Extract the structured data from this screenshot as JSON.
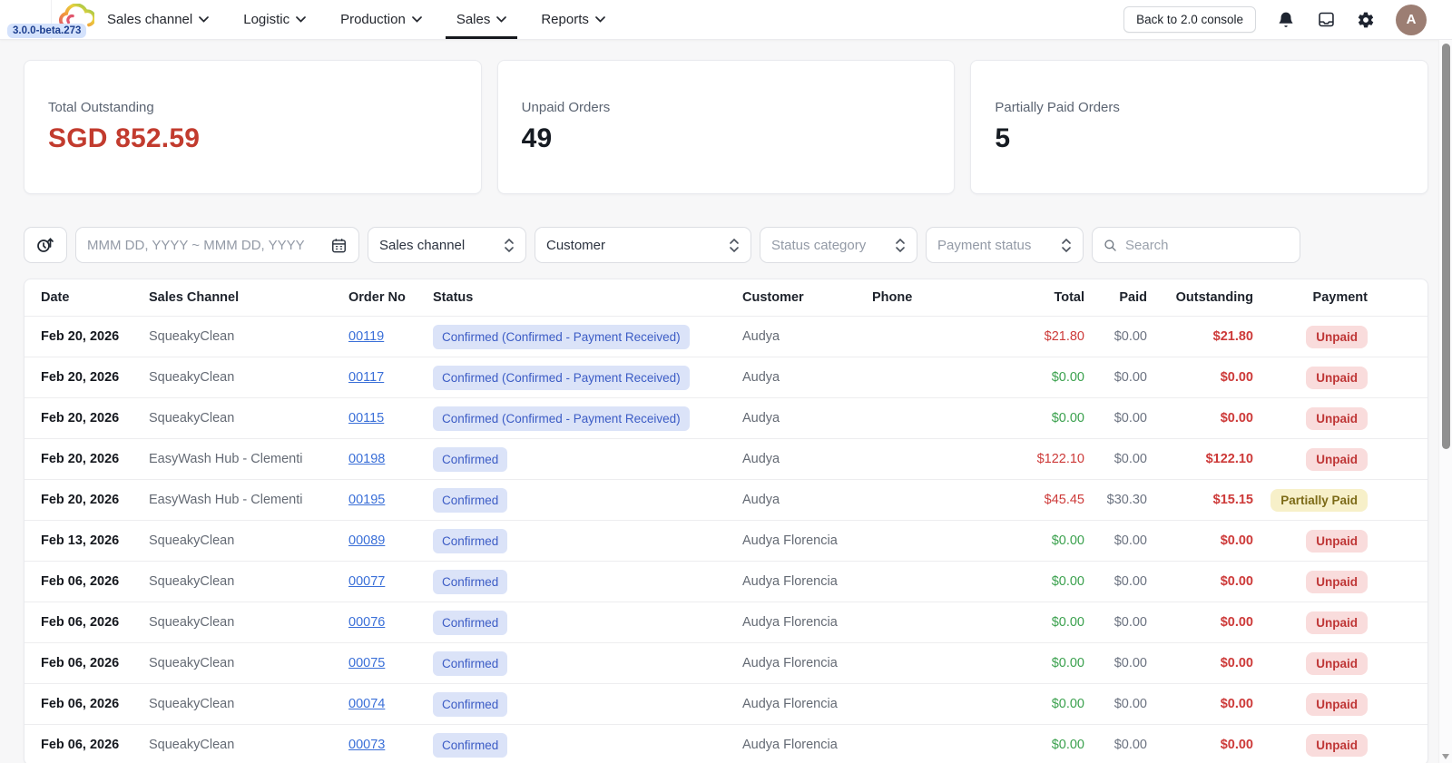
{
  "app": {
    "version_badge": "3.0.0-beta.273",
    "nav": [
      {
        "label": "Sales channel",
        "active": false
      },
      {
        "label": "Logistic",
        "active": false
      },
      {
        "label": "Production",
        "active": false
      },
      {
        "label": "Sales",
        "active": true
      },
      {
        "label": "Reports",
        "active": false
      }
    ],
    "back_button_label": "Back to 2.0 console",
    "avatar_initial": "A"
  },
  "cards": [
    {
      "label": "Total Outstanding",
      "value": "SGD 852.59"
    },
    {
      "label": "Unpaid Orders",
      "value": "49"
    },
    {
      "label": "Partially Paid Orders",
      "value": "5"
    }
  ],
  "filters": {
    "date_range_placeholder": "MMM DD, YYYY ~ MMM DD, YYYY",
    "dropdowns": [
      "Sales channel",
      "Customer",
      "Status category",
      "Payment status"
    ],
    "search_placeholder": "Search"
  },
  "table": {
    "columns": [
      "Date",
      "Sales Channel",
      "Order No",
      "Status",
      "Customer",
      "Phone",
      "Total",
      "Paid",
      "Outstanding",
      "Payment"
    ],
    "rows": [
      {
        "date": "Feb 20, 2026",
        "channel": "SqueakyClean",
        "order_no": "00119",
        "status": "Confirmed (Confirmed - Payment Received)",
        "customer": "Audya",
        "phone": "",
        "total": "$21.80",
        "paid": "$0.00",
        "outstanding": "$21.80",
        "payment": "Unpaid"
      },
      {
        "date": "Feb 20, 2026",
        "channel": "SqueakyClean",
        "order_no": "00117",
        "status": "Confirmed (Confirmed - Payment Received)",
        "customer": "Audya",
        "phone": "",
        "total": "$0.00",
        "paid": "$0.00",
        "outstanding": "$0.00",
        "payment": "Unpaid"
      },
      {
        "date": "Feb 20, 2026",
        "channel": "SqueakyClean",
        "order_no": "00115",
        "status": "Confirmed (Confirmed - Payment Received)",
        "customer": "Audya",
        "phone": "",
        "total": "$0.00",
        "paid": "$0.00",
        "outstanding": "$0.00",
        "payment": "Unpaid"
      },
      {
        "date": "Feb 20, 2026",
        "channel": "EasyWash Hub - Clementi",
        "order_no": "00198",
        "status": "Confirmed",
        "customer": "Audya",
        "phone": "",
        "total": "$122.10",
        "paid": "$0.00",
        "outstanding": "$122.10",
        "payment": "Unpaid"
      },
      {
        "date": "Feb 20, 2026",
        "channel": "EasyWash Hub - Clementi",
        "order_no": "00195",
        "status": "Confirmed",
        "customer": "Audya",
        "phone": "",
        "total": "$45.45",
        "paid": "$30.30",
        "outstanding": "$15.15",
        "payment": "Partially Paid"
      },
      {
        "date": "Feb 13, 2026",
        "channel": "SqueakyClean",
        "order_no": "00089",
        "status": "Confirmed",
        "customer": "Audya Florencia",
        "phone": "",
        "total": "$0.00",
        "paid": "$0.00",
        "outstanding": "$0.00",
        "payment": "Unpaid"
      },
      {
        "date": "Feb 06, 2026",
        "channel": "SqueakyClean",
        "order_no": "00077",
        "status": "Confirmed",
        "customer": "Audya Florencia",
        "phone": "",
        "total": "$0.00",
        "paid": "$0.00",
        "outstanding": "$0.00",
        "payment": "Unpaid"
      },
      {
        "date": "Feb 06, 2026",
        "channel": "SqueakyClean",
        "order_no": "00076",
        "status": "Confirmed",
        "customer": "Audya Florencia",
        "phone": "",
        "total": "$0.00",
        "paid": "$0.00",
        "outstanding": "$0.00",
        "payment": "Unpaid"
      },
      {
        "date": "Feb 06, 2026",
        "channel": "SqueakyClean",
        "order_no": "00075",
        "status": "Confirmed",
        "customer": "Audya Florencia",
        "phone": "",
        "total": "$0.00",
        "paid": "$0.00",
        "outstanding": "$0.00",
        "payment": "Unpaid"
      },
      {
        "date": "Feb 06, 2026",
        "channel": "SqueakyClean",
        "order_no": "00074",
        "status": "Confirmed",
        "customer": "Audya Florencia",
        "phone": "",
        "total": "$0.00",
        "paid": "$0.00",
        "outstanding": "$0.00",
        "payment": "Unpaid"
      },
      {
        "date": "Feb 06, 2026",
        "channel": "SqueakyClean",
        "order_no": "00073",
        "status": "Confirmed",
        "customer": "Audya Florencia",
        "phone": "",
        "total": "$0.00",
        "paid": "$0.00",
        "outstanding": "$0.00",
        "payment": "Unpaid"
      }
    ]
  },
  "colors": {
    "negative_red": "#cd3a39",
    "zero_green": "#3ba14e",
    "muted_gray": "#6b7280",
    "status_badge_bg": "#dbe3f8",
    "status_badge_text": "#3c5cc5",
    "unpaid_badge_bg": "#f9dcdc",
    "unpaid_badge_text": "#bf3636",
    "partial_badge_bg": "#f7f0c9",
    "partial_badge_text": "#7c6a17",
    "version_badge_bg": "#d4e2fc",
    "avatar_bg": "#9c7e73"
  }
}
